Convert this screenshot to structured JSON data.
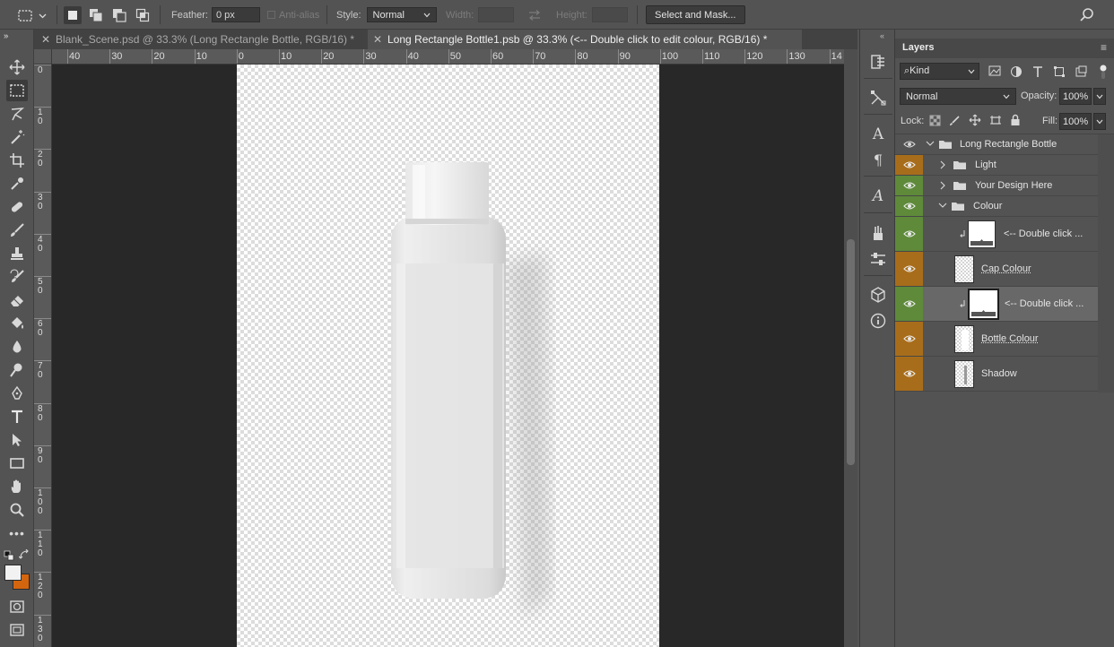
{
  "options_bar": {
    "feather_label": "Feather:",
    "feather_value": "0 px",
    "antialias_label": "Anti-alias",
    "style_label": "Style:",
    "style_value": "Normal",
    "width_label": "Width:",
    "height_label": "Height:",
    "select_mask_label": "Select and Mask..."
  },
  "tabs": [
    {
      "label": "Blank_Scene.psd @ 33.3% (Long Rectangle Bottle, RGB/16) *",
      "active": false
    },
    {
      "label": "Long Rectangle Bottle1.psb @ 33.3% (<-- Double click to edit colour, RGB/16) *",
      "active": true
    }
  ],
  "rulers": {
    "horizontal": [
      "40",
      "30",
      "20",
      "10",
      "0",
      "10",
      "20",
      "30",
      "40",
      "50",
      "60",
      "70",
      "80",
      "90",
      "100",
      "110",
      "120",
      "130",
      "14"
    ],
    "vertical": [
      "0",
      "1\n0",
      "2\n0",
      "3\n0",
      "4\n0",
      "5\n0",
      "6\n0",
      "7\n0",
      "8\n0",
      "9\n0",
      "1\n0\n0",
      "1\n1\n0",
      "1\n2\n0",
      "1\n3\n0"
    ]
  },
  "colors": {
    "foreground": "#f2f2f2",
    "background": "#d4650f",
    "visibility_orange": "#a86d1a",
    "visibility_green": "#5e8a3a"
  },
  "layers_panel": {
    "title": "Layers",
    "filter_kind": "Kind",
    "blend_mode": "Normal",
    "opacity_label": "Opacity:",
    "opacity_value": "100%",
    "lock_label": "Lock:",
    "fill_label": "Fill:",
    "fill_value": "100%",
    "layers": [
      {
        "name": "Long Rectangle Bottle",
        "kind": "group",
        "expanded": true,
        "indent": 0,
        "eye": "none"
      },
      {
        "name": "Light",
        "kind": "group",
        "expanded": false,
        "indent": 1,
        "eye": "orange"
      },
      {
        "name": "Your Design Here",
        "kind": "group",
        "expanded": false,
        "indent": 1,
        "eye": "green"
      },
      {
        "name": "Colour",
        "kind": "group",
        "expanded": true,
        "indent": 1,
        "eye": "green"
      },
      {
        "name": "<-- Double click ...",
        "kind": "fill",
        "indent": 2,
        "eye": "green",
        "clipped": true
      },
      {
        "name": "Cap Colour",
        "kind": "pixel",
        "indent": 2,
        "eye": "orange"
      },
      {
        "name": "<-- Double click ...",
        "kind": "fill",
        "indent": 2,
        "eye": "green",
        "clipped": true,
        "selected": true
      },
      {
        "name": "Bottle Colour",
        "kind": "pixel",
        "indent": 2,
        "eye": "orange"
      },
      {
        "name": "Shadow",
        "kind": "pixel",
        "indent": 2,
        "eye": "orange"
      }
    ]
  }
}
